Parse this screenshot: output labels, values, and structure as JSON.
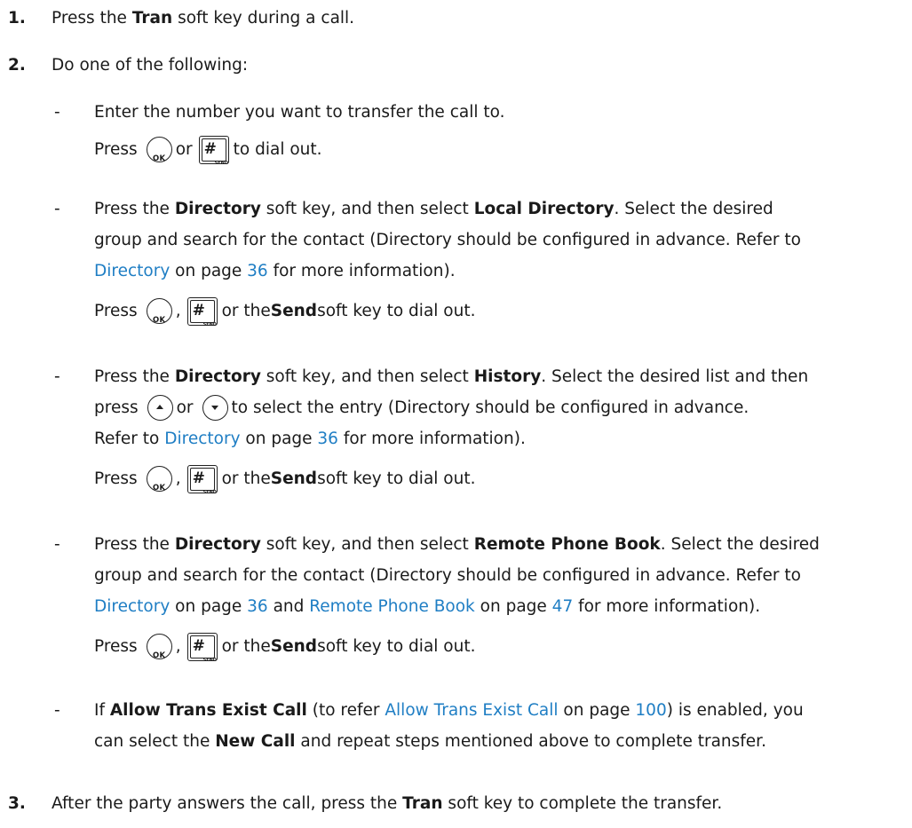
{
  "steps": [
    {
      "num": "1.",
      "parts": [
        {
          "t": "Press the "
        },
        {
          "t": "Tran",
          "b": true
        },
        {
          "t": " soft key during a call."
        }
      ]
    },
    {
      "num": "2.",
      "text": "Do one of the following:",
      "options": [
        {
          "lines": [
            [
              {
                "t": "Enter the number you want to transfer the call to."
              }
            ]
          ],
          "press": [
            {
              "t": "Press"
            },
            {
              "key": "ok"
            },
            {
              "t": "or"
            },
            {
              "key": "send"
            },
            {
              "t": "to dial out."
            }
          ]
        },
        {
          "lines": [
            [
              {
                "t": "Press the "
              },
              {
                "t": "Directory",
                "b": true
              },
              {
                "t": " soft key, and then select "
              },
              {
                "t": "Local Directory",
                "b": true
              },
              {
                "t": ". Select the desired"
              }
            ],
            [
              {
                "t": "group and search for the contact (Directory should be configured in advance. Refer to"
              }
            ],
            [
              {
                "t": "Directory",
                "link": true
              },
              {
                "t": " on page "
              },
              {
                "t": "36",
                "link": true
              },
              {
                "t": " for more information)."
              }
            ]
          ],
          "press": [
            {
              "t": "Press"
            },
            {
              "key": "ok"
            },
            {
              "t": ","
            },
            {
              "key": "send"
            },
            {
              "t": "or the "
            },
            {
              "t": "Send",
              "b": true
            },
            {
              "t": " soft key to dial out."
            }
          ]
        },
        {
          "lines": [
            [
              {
                "t": "Press the "
              },
              {
                "t": "Directory",
                "b": true
              },
              {
                "t": " soft key, and then select "
              },
              {
                "t": "History",
                "b": true
              },
              {
                "t": ". Select the desired list and then"
              }
            ],
            [
              {
                "t": "press"
              },
              {
                "key": "up"
              },
              {
                "t": "or"
              },
              {
                "key": "down"
              },
              {
                "t": "to select the entry (Directory should be configured in advance."
              }
            ],
            [
              {
                "t": "Refer to "
              },
              {
                "t": "Directory",
                "link": true
              },
              {
                "t": " on page "
              },
              {
                "t": "36",
                "link": true
              },
              {
                "t": " for more information)."
              }
            ]
          ],
          "press": [
            {
              "t": "Press"
            },
            {
              "key": "ok"
            },
            {
              "t": ","
            },
            {
              "key": "send"
            },
            {
              "t": "or the "
            },
            {
              "t": "Send",
              "b": true
            },
            {
              "t": " soft key to dial out."
            }
          ]
        },
        {
          "lines": [
            [
              {
                "t": "Press the "
              },
              {
                "t": "Directory",
                "b": true
              },
              {
                "t": " soft key, and then select "
              },
              {
                "t": "Remote Phone Book",
                "b": true
              },
              {
                "t": ". Select the desired"
              }
            ],
            [
              {
                "t": "group and search for the contact (Directory should be configured in advance. Refer to"
              }
            ],
            [
              {
                "t": "Directory",
                "link": true
              },
              {
                "t": " on page "
              },
              {
                "t": "36",
                "link": true
              },
              {
                "t": " and "
              },
              {
                "t": "Remote Phone Book",
                "link": true
              },
              {
                "t": " on page "
              },
              {
                "t": "47",
                "link": true
              },
              {
                "t": " for more information)."
              }
            ]
          ],
          "press": [
            {
              "t": "Press"
            },
            {
              "key": "ok"
            },
            {
              "t": ","
            },
            {
              "key": "send"
            },
            {
              "t": "or the "
            },
            {
              "t": "Send",
              "b": true
            },
            {
              "t": " soft key to dial out."
            }
          ]
        },
        {
          "lines": [
            [
              {
                "t": "If "
              },
              {
                "t": "Allow Trans Exist Call",
                "b": true
              },
              {
                "t": " (to refer "
              },
              {
                "t": "Allow Trans Exist Call",
                "link": true
              },
              {
                "t": " on page "
              },
              {
                "t": "100",
                "link": true
              },
              {
                "t": ") is enabled, you"
              }
            ],
            [
              {
                "t": "can select the "
              },
              {
                "t": "New Call",
                "b": true
              },
              {
                "t": " and repeat steps mentioned above to complete transfer."
              }
            ]
          ]
        }
      ]
    },
    {
      "num": "3.",
      "parts": [
        {
          "t": "After the party answers the call, press the "
        },
        {
          "t": "Tran",
          "b": true
        },
        {
          "t": " soft key to complete the transfer."
        }
      ]
    }
  ],
  "keys": {
    "ok_label": "OK",
    "send_hash": "#",
    "send_label": "SEND",
    "dash": "-"
  },
  "colors": {
    "link": "#1f7ec4",
    "text": "#1a1a1a"
  },
  "icons": {
    "ok": "ok-key-icon",
    "send": "send-key-icon",
    "up": "up-arrow-key-icon",
    "down": "down-arrow-key-icon"
  }
}
